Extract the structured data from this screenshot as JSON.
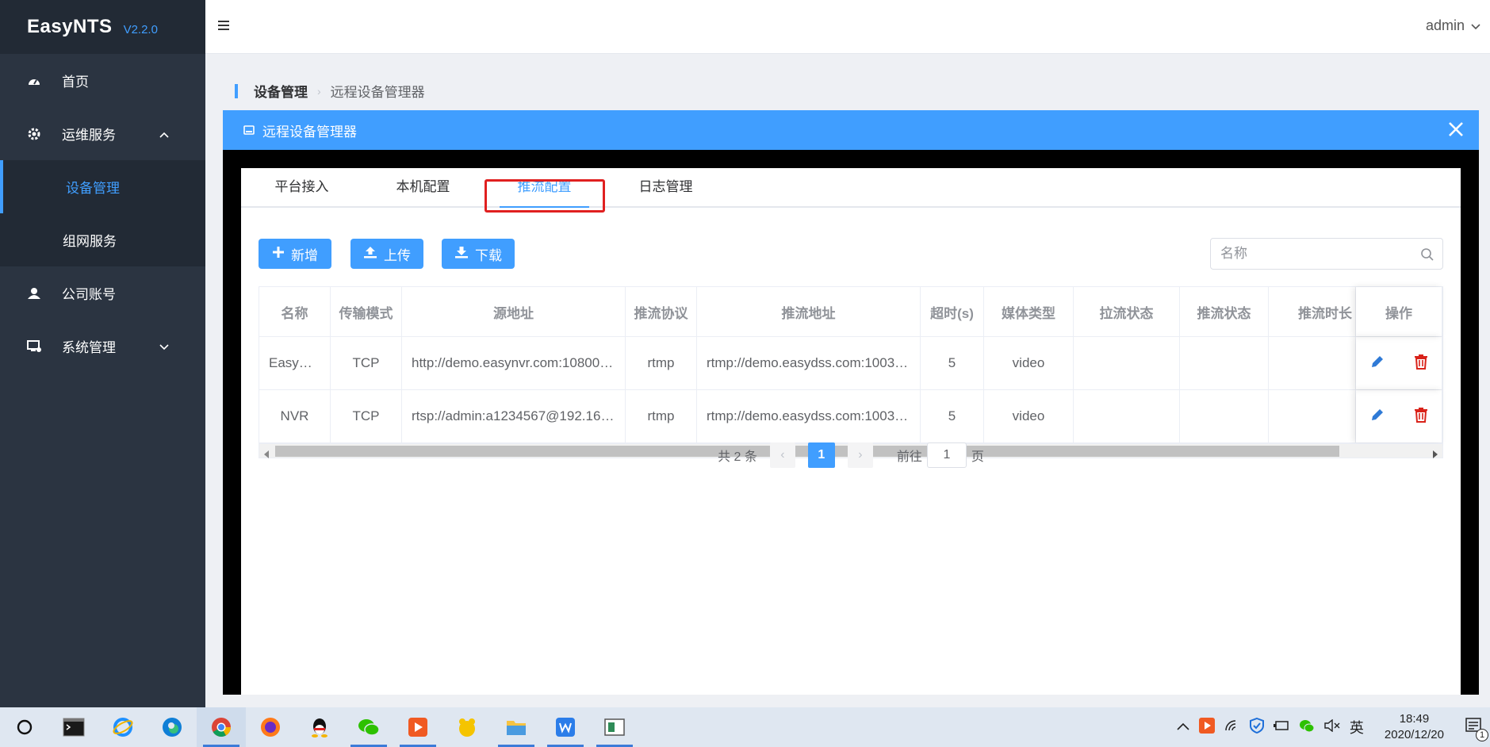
{
  "app": {
    "name": "EasyNTS",
    "version": "V2.2.0"
  },
  "sidebar": {
    "items": [
      {
        "label": "首页"
      },
      {
        "label": "运维服务"
      },
      {
        "label": "设备管理"
      },
      {
        "label": "组网服务"
      },
      {
        "label": "公司账号"
      },
      {
        "label": "系统管理"
      }
    ]
  },
  "header": {
    "user": "admin"
  },
  "breadcrumb": {
    "parent": "设备管理",
    "current": "远程设备管理器"
  },
  "dialog": {
    "title": "远程设备管理器",
    "tabs": [
      {
        "label": "平台接入"
      },
      {
        "label": "本机配置"
      },
      {
        "label": "推流配置"
      },
      {
        "label": "日志管理"
      }
    ],
    "active_tab": "推流配置",
    "toolbar": {
      "add": "新增",
      "upload": "上传",
      "download": "下载"
    },
    "search": {
      "placeholder": "名称",
      "value": ""
    },
    "table": {
      "columns": [
        "名称",
        "传输模式",
        "源地址",
        "推流协议",
        "推流地址",
        "超时(s)",
        "媒体类型",
        "拉流状态",
        "推流状态",
        "推流时长",
        "操作"
      ],
      "rows": [
        {
          "name": "EasyN…",
          "mode": "TCP",
          "source": "http://demo.easynvr.com:10800/flv…",
          "protocol": "rtmp",
          "push_url": "rtmp://demo.easydss.com:10035/h…",
          "timeout": "5",
          "media": "video",
          "pull_status": "",
          "push_status": "",
          "duration": ""
        },
        {
          "name": "NVR",
          "mode": "TCP",
          "source": "rtsp://admin:a1234567@192.168.…",
          "protocol": "rtmp",
          "push_url": "rtmp://demo.easydss.com:10035/h…",
          "timeout": "5",
          "media": "video",
          "pull_status": "",
          "push_status": "",
          "duration": ""
        }
      ]
    },
    "pagination": {
      "total_text": "共 2 条",
      "current_page": "1",
      "goto_label": "前往",
      "goto_value": "1",
      "page_suffix": "页"
    }
  },
  "taskbar": {
    "apps": [
      "cortana-icon",
      "terminal-icon",
      "ie-icon",
      "edge-icon",
      "chrome-icon",
      "firefox-icon",
      "qq-icon",
      "wechat-icon",
      "media-player-icon",
      "app-yellow-icon",
      "file-explorer-icon",
      "wps-icon",
      "monitor-app-icon"
    ],
    "ime": "英",
    "time": "18:49",
    "date": "2020/12/20",
    "notification_count": "1"
  },
  "colors": {
    "primary": "#409eff",
    "sidebar_bg": "#2b3441",
    "danger": "#e02020",
    "edit": "#2f7ad6",
    "delete": "#d9231a"
  }
}
